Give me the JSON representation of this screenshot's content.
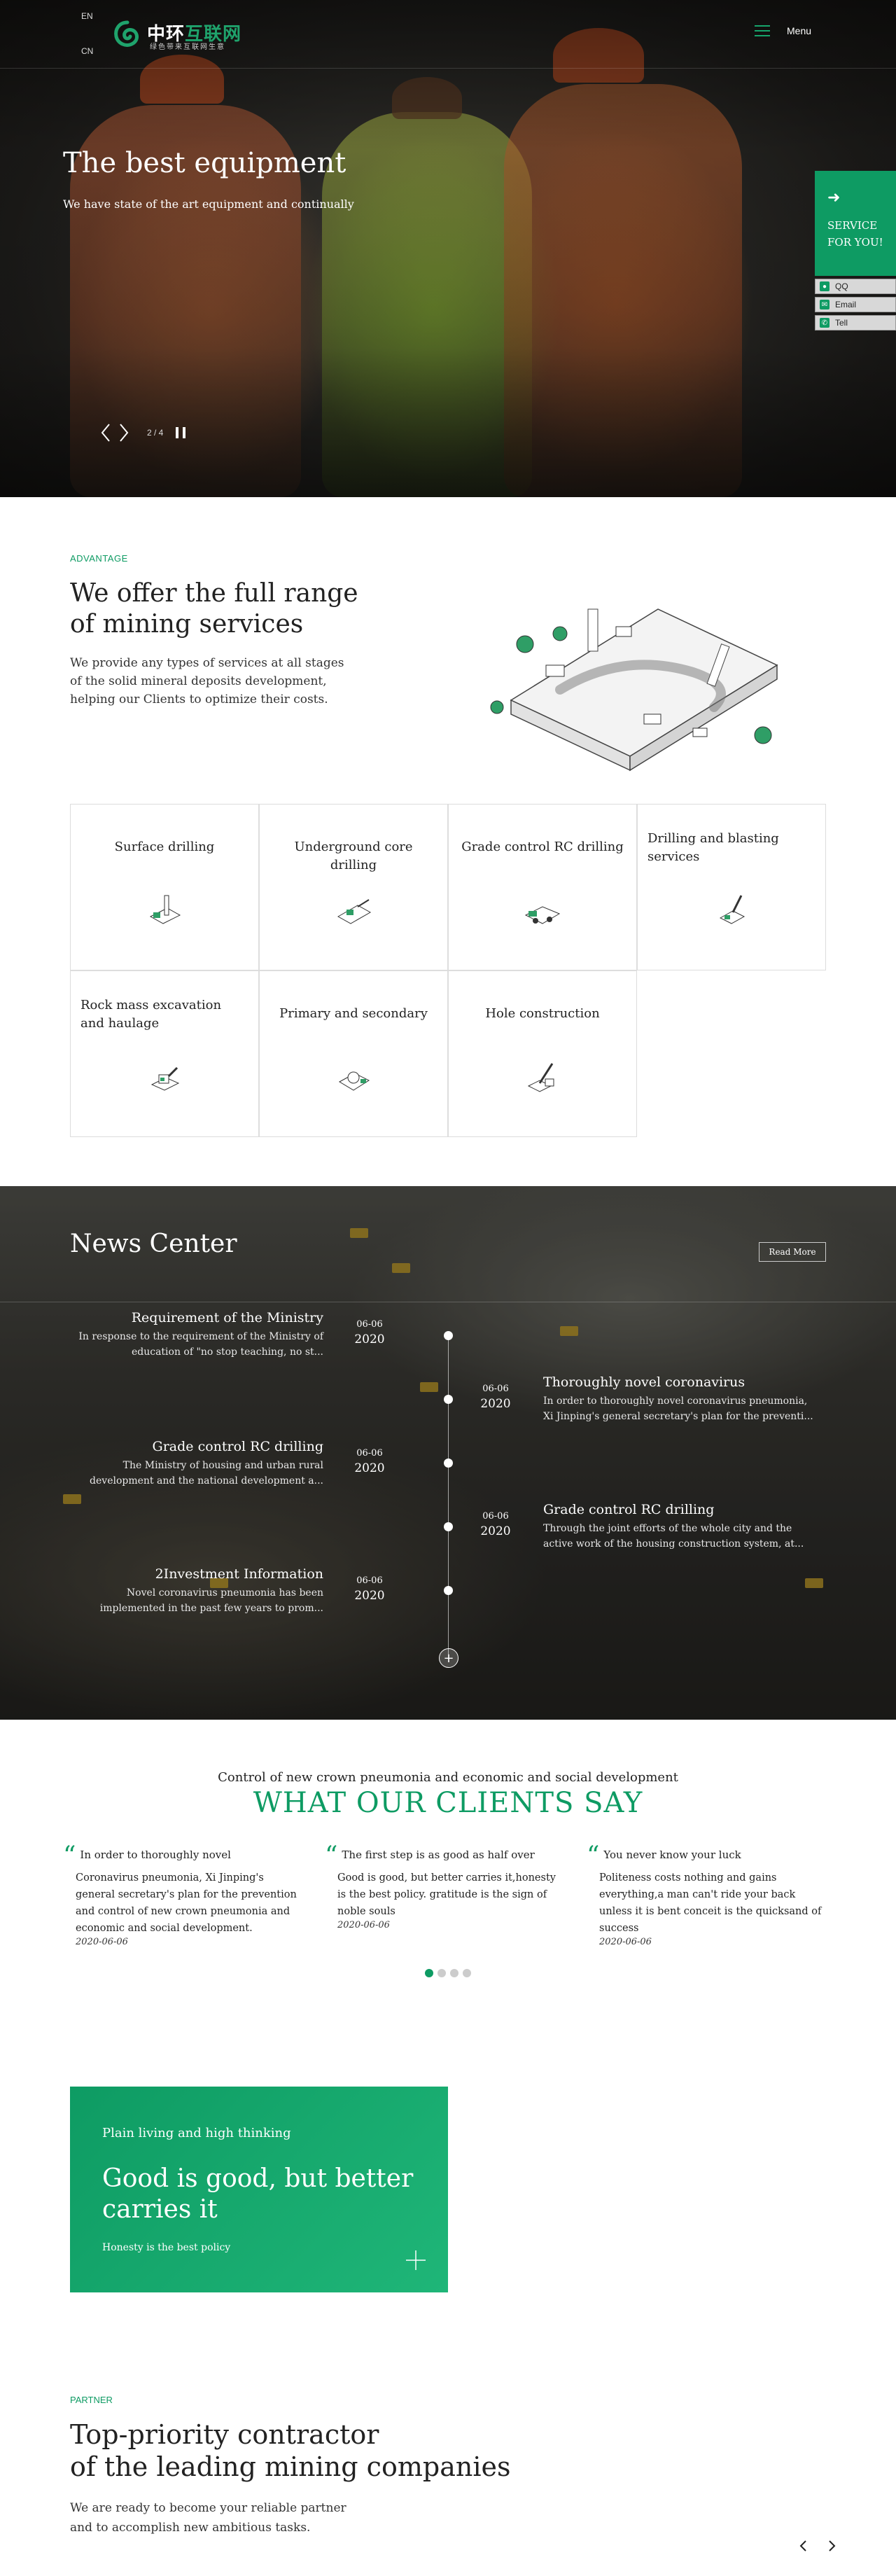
{
  "header": {
    "lang_en": "EN",
    "lang_cn": "CN",
    "logo_main_1": "中环",
    "logo_main_2": "互联网",
    "logo_sub": "绿色带来互联网生意",
    "menu_label": "Menu"
  },
  "hero": {
    "title": "The best equipment",
    "subtitle": "We have state of the art equipment and continually",
    "pager": "2 / 4"
  },
  "service_widget": {
    "label_line1": "SERVICE",
    "label_line2": "FOR YOU!",
    "links": [
      {
        "icon": "person-icon",
        "label": "QQ"
      },
      {
        "icon": "mail-icon",
        "label": "Email"
      },
      {
        "icon": "phone-icon",
        "label": "Tell"
      }
    ]
  },
  "advantage": {
    "kicker": "ADVANTAGE",
    "title_line1": "We offer the full range",
    "title_line2": "of mining services",
    "desc_line1": "We provide any types of services at all stages",
    "desc_line2": "of the solid mineral deposits development,",
    "desc_line3": "helping our Clients to optimize their costs.",
    "services": [
      {
        "label": "Surface drilling"
      },
      {
        "label": "Underground core drilling"
      },
      {
        "label": "Grade control RC drilling"
      },
      {
        "label": "Drilling and blasting services"
      },
      {
        "label": "Rock mass excavation and haulage"
      },
      {
        "label": "Primary and secondary"
      },
      {
        "label": "Hole construction"
      }
    ]
  },
  "news": {
    "title": "News Center",
    "read_more": "Read More",
    "items": [
      {
        "title": "Requirement of the Ministry",
        "desc_line1": "In response to the requirement of the Ministry of",
        "desc_line2": "education of \"no stop teaching, no st...",
        "date_md": "06-06",
        "date_y": "2020"
      },
      {
        "title": "Thoroughly novel coronavirus",
        "desc_line1": "In order to thoroughly novel coronavirus pneumonia,",
        "desc_line2": "Xi Jinping's general secretary's plan for the preventi...",
        "date_md": "06-06",
        "date_y": "2020"
      },
      {
        "title": "Grade control RC drilling",
        "desc_line1": "The Ministry of housing and urban rural",
        "desc_line2": "development and the national development a...",
        "date_md": "06-06",
        "date_y": "2020"
      },
      {
        "title": "Grade control RC drilling",
        "desc_line1": "Through the joint efforts of the whole city and the",
        "desc_line2": "active work of the housing construction system, at...",
        "date_md": "06-06",
        "date_y": "2020"
      },
      {
        "title": "2Investment Information",
        "desc_line1": "Novel coronavirus pneumonia has been",
        "desc_line2": "implemented in the past few years to prom...",
        "date_md": "06-06",
        "date_y": "2020"
      }
    ]
  },
  "clients": {
    "kicker": "Control of new crown pneumonia and economic and social development",
    "title": "WHAT OUR CLIENTS SAY",
    "quotes": [
      {
        "title": "In order to thoroughly novel",
        "body": "Coronavirus pneumonia, Xi Jinping's general secretary's plan for the prevention and control of new crown pneumonia and economic and social development.",
        "date": "2020-06-06"
      },
      {
        "title": "The first step is as good as half over",
        "body": "Good is good, but better carries it,honesty is the best policy. gratitude is the sign of noble souls",
        "date": "2020-06-06"
      },
      {
        "title": "You never know your luck",
        "body": "Politeness costs nothing and gains everything,a man can't ride your back unless it is bent conceit is the quicksand of success",
        "date": "2020-06-06"
      }
    ],
    "active_dot": 1,
    "dot_count": 4
  },
  "card": {
    "kicker": "Plain living and high thinking",
    "title": "Good is good, but better carries it",
    "subtitle": "Honesty is the best policy"
  },
  "partner": {
    "kicker": "PARTNER",
    "title_line1": "Top-priority contractor",
    "title_line2": "of the leading mining companies",
    "desc_line1": "We are ready to become your reliable partner",
    "desc_line2": "and to accomplish new ambitious tasks."
  },
  "colors": {
    "accent": "#0e9b63",
    "dark": "#1c1b19"
  }
}
